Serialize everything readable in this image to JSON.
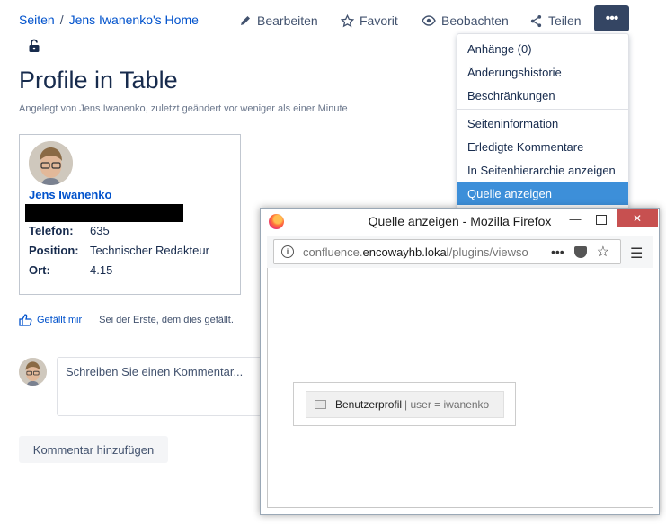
{
  "breadcrumb": {
    "items": [
      "Seiten",
      "Jens Iwanenko's Home"
    ],
    "separator": "/"
  },
  "toolbar": {
    "edit": "Bearbeiten",
    "favorite": "Favorit",
    "watch": "Beobachten",
    "share": "Teilen",
    "more": "•••"
  },
  "page": {
    "title": "Profile in Table",
    "byline": "Angelegt von Jens Iwanenko, zuletzt geändert vor weniger als einer Minute"
  },
  "profile": {
    "name": "Jens Iwanenko",
    "fields": [
      {
        "label": "Telefon:",
        "value": "635"
      },
      {
        "label": "Position:",
        "value": "Technischer Redakteur"
      },
      {
        "label": "Ort:",
        "value": "4.15"
      }
    ]
  },
  "likes": {
    "label": "Gefällt mir",
    "hint": "Sei der Erste, dem dies gefällt."
  },
  "comment": {
    "placeholder": "Schreiben Sie einen Kommentar...",
    "add_button": "Kommentar hinzufügen"
  },
  "dropdown": {
    "group1": [
      "Anhänge (0)",
      "Änderungshistorie",
      "Beschränkungen"
    ],
    "group2": [
      "Seiteninformation",
      "Erledigte Kommentare",
      "In Seitenhierarchie anzeigen",
      "Quelle anzeigen"
    ],
    "active_item": "Quelle anzeigen"
  },
  "firefox": {
    "title": "Quelle anzeigen - Mozilla Firefox",
    "url_prefix": "confluence.",
    "url_host": "encowayhb.lokal",
    "url_path": "/plugins/viewso",
    "macro_name": "Benutzerprofil",
    "macro_params": "| user = iwanenko"
  },
  "colors": {
    "accent": "#0052cc",
    "more_button": "#344563",
    "dropdown_active": "#3d8fd9",
    "close_button": "#c75050"
  }
}
